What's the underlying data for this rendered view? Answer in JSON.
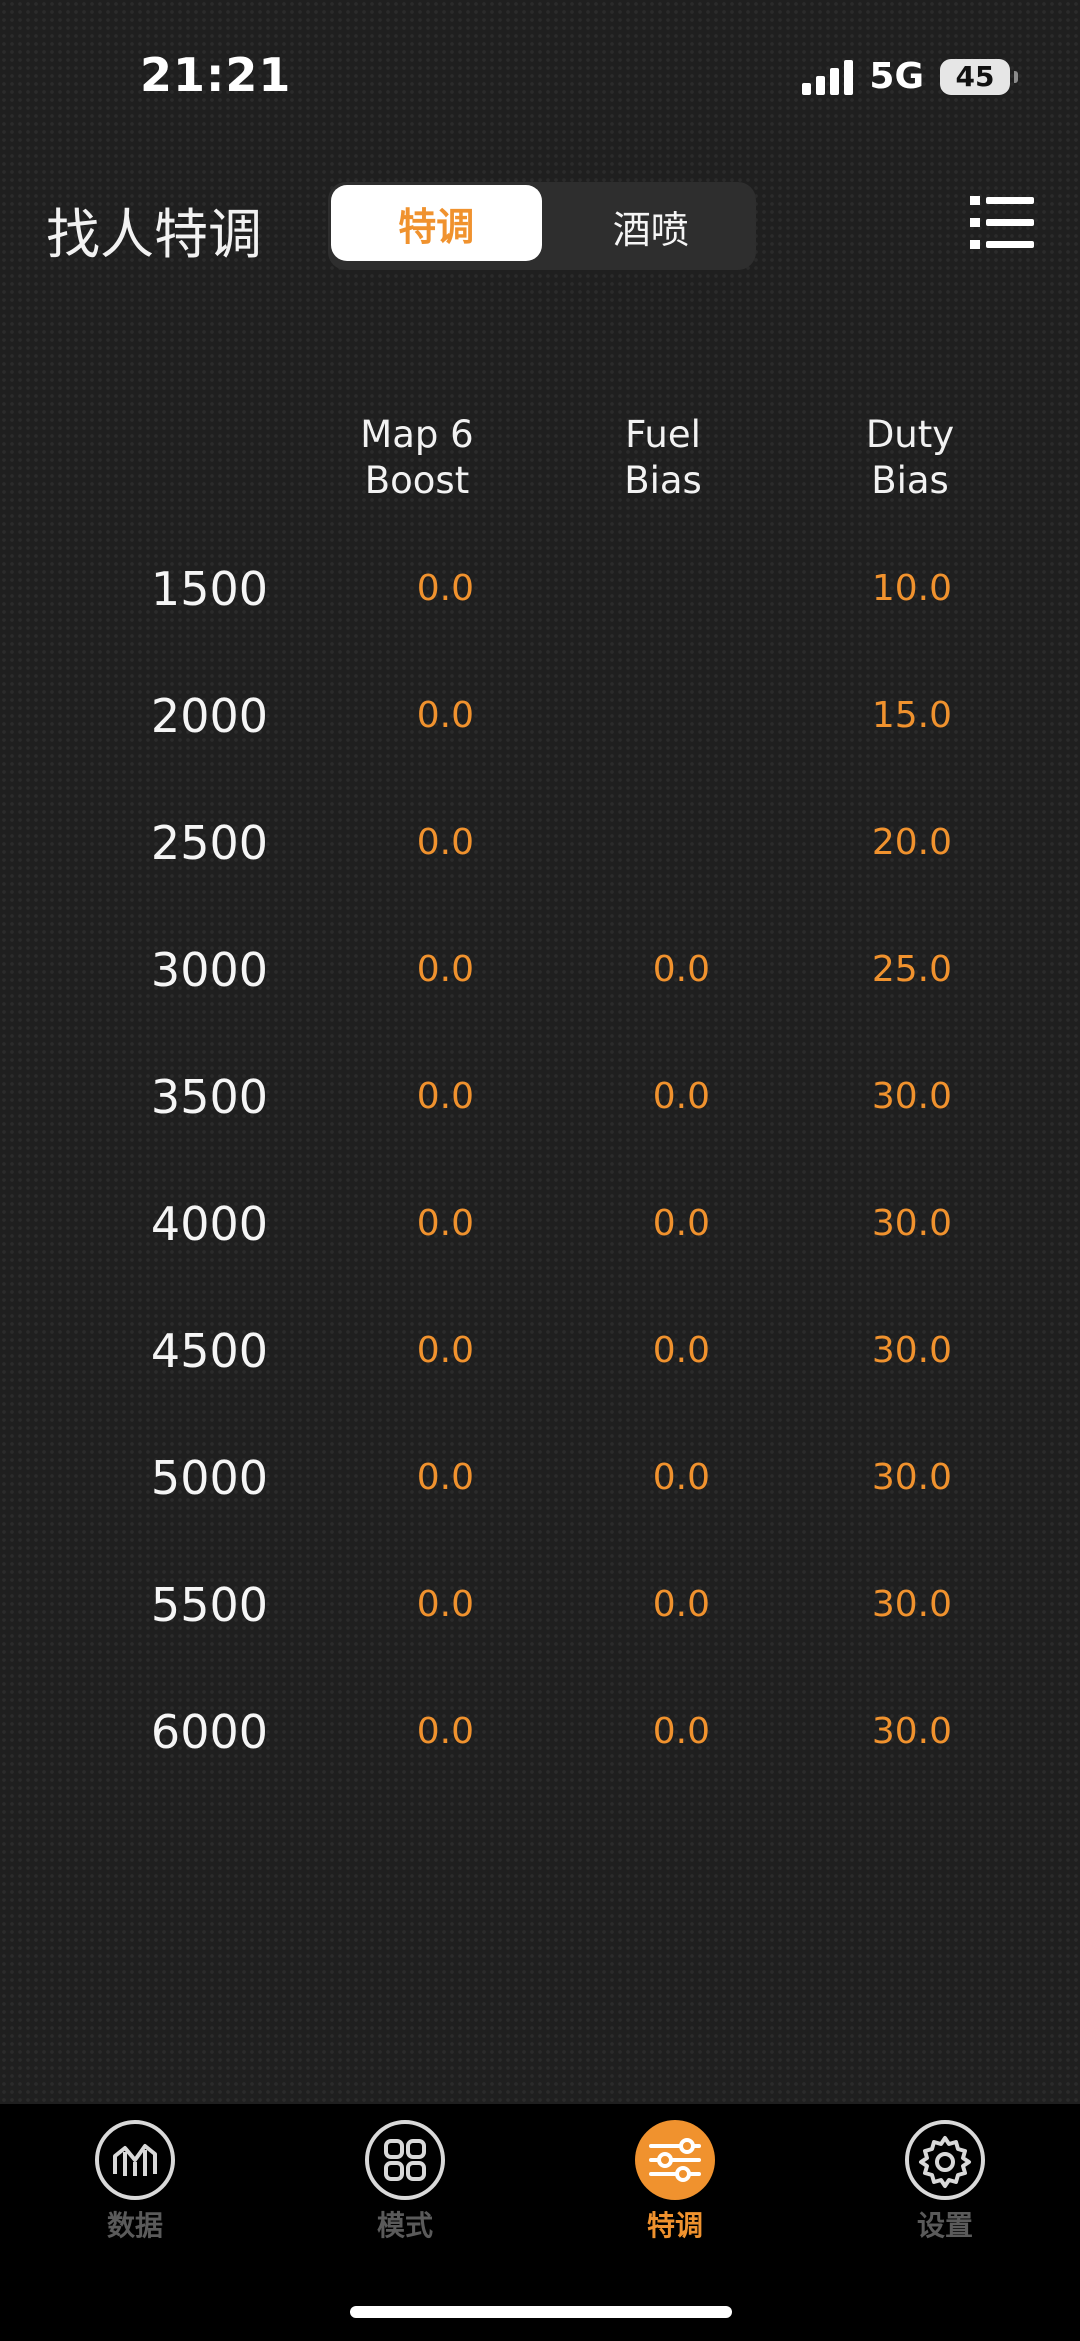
{
  "status_bar": {
    "time": "21:21",
    "network": "5G",
    "battery": "45"
  },
  "header": {
    "title": "找人特调",
    "segments": [
      {
        "label": "特调",
        "selected": true
      },
      {
        "label": "酒喷",
        "selected": false
      }
    ],
    "menu_icon": "list-menu-icon"
  },
  "table": {
    "columns": [
      {
        "line1": "Map 6",
        "line2": "Boost"
      },
      {
        "line1": "Fuel",
        "line2": "Bias"
      },
      {
        "line1": "Duty",
        "line2": "Bias"
      }
    ],
    "rows": [
      {
        "rpm": "1500",
        "boost": "0.0",
        "fuel": "",
        "duty": "10.0"
      },
      {
        "rpm": "2000",
        "boost": "0.0",
        "fuel": "",
        "duty": "15.0"
      },
      {
        "rpm": "2500",
        "boost": "0.0",
        "fuel": "",
        "duty": "20.0"
      },
      {
        "rpm": "3000",
        "boost": "0.0",
        "fuel": "0.0",
        "duty": "25.0"
      },
      {
        "rpm": "3500",
        "boost": "0.0",
        "fuel": "0.0",
        "duty": "30.0"
      },
      {
        "rpm": "4000",
        "boost": "0.0",
        "fuel": "0.0",
        "duty": "30.0"
      },
      {
        "rpm": "4500",
        "boost": "0.0",
        "fuel": "0.0",
        "duty": "30.0"
      },
      {
        "rpm": "5000",
        "boost": "0.0",
        "fuel": "0.0",
        "duty": "30.0"
      },
      {
        "rpm": "5500",
        "boost": "0.0",
        "fuel": "0.0",
        "duty": "30.0"
      },
      {
        "rpm": "6000",
        "boost": "0.0",
        "fuel": "0.0",
        "duty": "30.0"
      }
    ]
  },
  "tabbar": {
    "tabs": [
      {
        "label": "数据",
        "icon": "chart-icon",
        "active": false
      },
      {
        "label": "模式",
        "icon": "grid-icon",
        "active": false
      },
      {
        "label": "特调",
        "icon": "sliders-icon",
        "active": true
      },
      {
        "label": "设置",
        "icon": "gear-icon",
        "active": false
      }
    ]
  },
  "colors": {
    "accent": "#f0922e",
    "background": "#1f1f1f",
    "tabbar": "#000000",
    "inactive_tab_label": "#5a5a5a"
  }
}
